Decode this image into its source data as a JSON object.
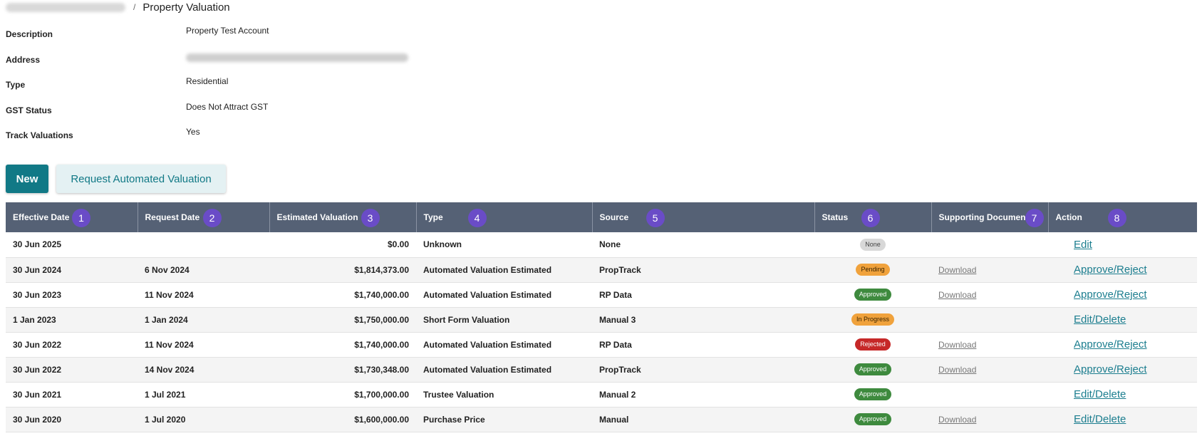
{
  "breadcrumb": {
    "parent_label": "",
    "separator": "/",
    "current_label": "Property Valuation"
  },
  "details": [
    {
      "label": "Description",
      "value": "Property Test Account"
    },
    {
      "label": "Address",
      "value": ""
    },
    {
      "label": "Type",
      "value": "Residential"
    },
    {
      "label": "GST Status",
      "value": "Does Not Attract GST"
    },
    {
      "label": "Track Valuations",
      "value": "Yes"
    }
  ],
  "buttons": {
    "new_label": "New",
    "request_label": "Request Automated Valuation"
  },
  "table": {
    "columns": [
      {
        "label": "Effective Date",
        "marker": "1"
      },
      {
        "label": "Request Date",
        "marker": "2"
      },
      {
        "label": "Estimated Valuation",
        "marker": "3"
      },
      {
        "label": "Type",
        "marker": "4"
      },
      {
        "label": "Source",
        "marker": "5"
      },
      {
        "label": "Status",
        "marker": "6"
      },
      {
        "label": "Supporting Document",
        "marker": "7"
      },
      {
        "label": "Action",
        "marker": "8"
      }
    ],
    "rows": [
      {
        "effective": "30 Jun 2025",
        "request": "",
        "valuation": "$0.00",
        "type": "Unknown",
        "source": "None",
        "status": "None",
        "status_kind": "none",
        "document": "",
        "action": "Edit"
      },
      {
        "effective": "30 Jun 2024",
        "request": "6 Nov 2024",
        "valuation": "$1,814,373.00",
        "type": "Automated Valuation Estimated",
        "source": "PropTrack",
        "status": "Pending",
        "status_kind": "pending",
        "document": "Download",
        "action": "Approve/Reject"
      },
      {
        "effective": "30 Jun 2023",
        "request": "11 Nov 2024",
        "valuation": "$1,740,000.00",
        "type": "Automated Valuation Estimated",
        "source": "RP Data",
        "status": "Approved",
        "status_kind": "approved",
        "document": "Download",
        "action": "Approve/Reject"
      },
      {
        "effective": "1 Jan 2023",
        "request": "1 Jan 2024",
        "valuation": "$1,750,000.00",
        "type": "Short Form Valuation",
        "source": "Manual 3",
        "status": "In Progress",
        "status_kind": "inprogress",
        "document": "",
        "action": "Edit/Delete"
      },
      {
        "effective": "30 Jun 2022",
        "request": "11 Nov 2024",
        "valuation": "$1,740,000.00",
        "type": "Automated Valuation Estimated",
        "source": "RP Data",
        "status": "Rejected",
        "status_kind": "rejected",
        "document": "Download",
        "action": "Approve/Reject"
      },
      {
        "effective": "30 Jun 2022",
        "request": "14 Nov 2024",
        "valuation": "$1,730,348.00",
        "type": "Automated Valuation Estimated",
        "source": "PropTrack",
        "status": "Approved",
        "status_kind": "approved",
        "document": "Download",
        "action": "Approve/Reject"
      },
      {
        "effective": "30 Jun 2021",
        "request": "1 Jul 2021",
        "valuation": "$1,700,000.00",
        "type": "Trustee Valuation",
        "source": "Manual 2",
        "status": "Approved",
        "status_kind": "approved",
        "document": "",
        "action": "Edit/Delete"
      },
      {
        "effective": "30 Jun 2020",
        "request": "1 Jul 2020",
        "valuation": "$1,600,000.00",
        "type": "Purchase Price",
        "source": "Manual",
        "status": "Approved",
        "status_kind": "approved",
        "document": "Download",
        "action": "Edit/Delete"
      }
    ]
  },
  "colors": {
    "header_bg": "#556175",
    "primary": "#117986",
    "marker": "#6a4cc7",
    "link": "#1c7e8f"
  }
}
